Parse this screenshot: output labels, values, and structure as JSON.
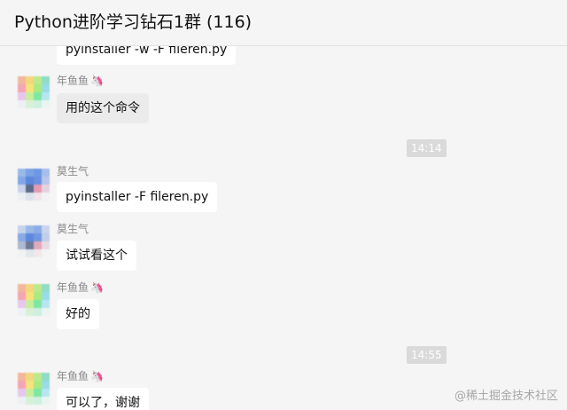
{
  "header": {
    "title": "Python进阶学习钻石1群 (116)"
  },
  "messages": [
    {
      "sender": "",
      "text": "pyinstaller -w -F fileren.py"
    },
    {
      "sender": "年鱼鱼",
      "text": "用的这个命令"
    },
    {
      "time": "14:14"
    },
    {
      "sender": "莫生气",
      "text": "pyinstaller -F fileren.py"
    },
    {
      "sender": "莫生气",
      "text": "试试看这个"
    },
    {
      "sender": "年鱼鱼",
      "text": "好的"
    },
    {
      "time": "14:55"
    },
    {
      "sender": "年鱼鱼",
      "text": "可以了，谢谢"
    }
  ],
  "watermark": "@稀土掘金技术社区",
  "colors": {
    "background": "#f5f5f5",
    "bubble": "#ffffff",
    "bubble_highlight": "#ebebeb",
    "timestamp_bg": "#dadada"
  },
  "icons": {
    "sender_badge": "unicorn-icon"
  }
}
